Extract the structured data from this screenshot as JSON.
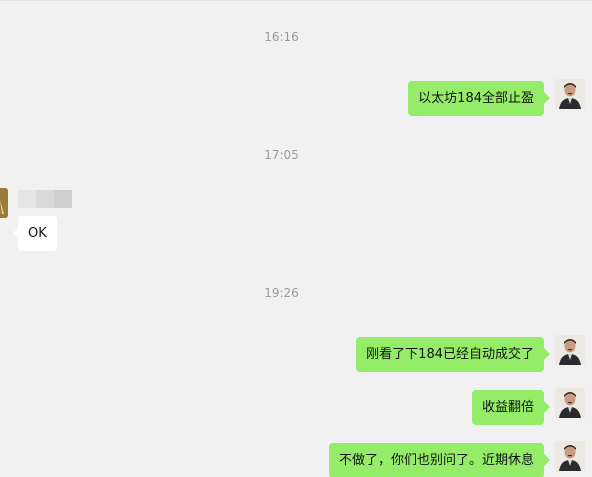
{
  "timestamps": [
    "16:16",
    "17:05",
    "19:26"
  ],
  "messages": [
    {
      "direction": "out",
      "text": "以太坊184全部止盈"
    },
    {
      "direction": "in",
      "text": "OK"
    },
    {
      "direction": "out",
      "text": "刚看了下184已经自动成交了"
    },
    {
      "direction": "out",
      "text": "收益翻倍"
    },
    {
      "direction": "out",
      "text": "不做了，你们也别问了。近期休息"
    }
  ],
  "colors": {
    "background": "#f1f1f1",
    "outgoing_bubble": "#95ec69",
    "incoming_bubble": "#ffffff",
    "timestamp": "#9a9a9a"
  },
  "icons": {
    "self_avatar": "user-avatar-icon",
    "contact_avatar": "contact-avatar-icon"
  }
}
